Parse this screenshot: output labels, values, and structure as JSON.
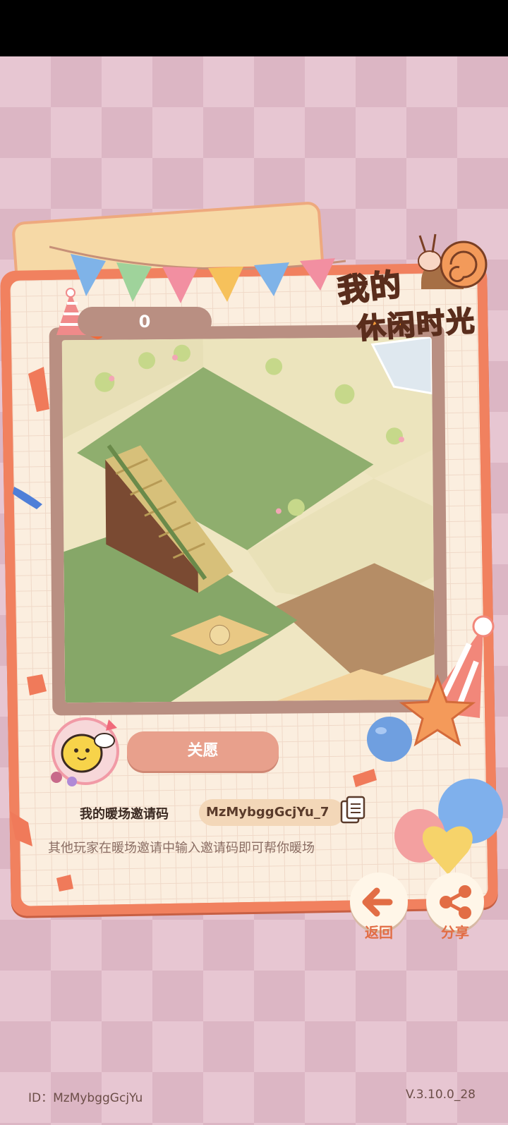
{
  "score": "0",
  "logo": {
    "line1": "我的",
    "line2": "休闲时光"
  },
  "wish_button": "关愿",
  "invite": {
    "label": "我的暖场邀请码",
    "code": "MzMybggGcjYu_7",
    "hint": "其他玩家在暖场邀请中输入邀请码即可帮你暖场"
  },
  "actions": {
    "back": "返回",
    "share": "分享"
  },
  "footer": {
    "id": "ID：MzMybggGcjYu",
    "version": "V.3.10.0_28"
  },
  "colors": {
    "card_border": "#f1815f",
    "frame": "#b98f82",
    "accent_orange": "#e26d45",
    "wish_button": "#e8a08c",
    "background_pink": "#e7c6d2"
  },
  "icons": [
    "party-hat-icon",
    "snail-icon",
    "bee-badge-icon",
    "copy-icon",
    "back-arrow-icon",
    "share-icon",
    "balloon-icon",
    "star-icon"
  ]
}
